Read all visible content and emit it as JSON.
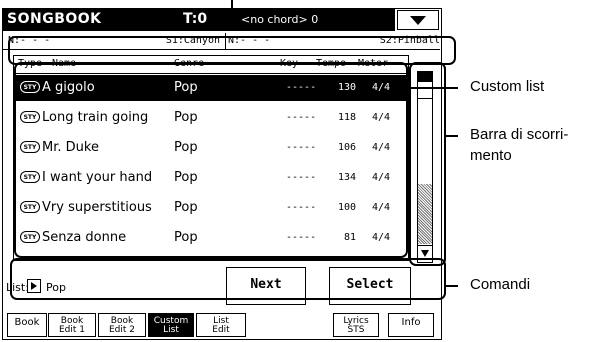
{
  "header": {
    "title": "SONGBOOK",
    "transpose": "T:0",
    "chord": "<no chord> 0"
  },
  "player_info": [
    {
      "n": "N:- - -",
      "song": "S1:Canyon"
    },
    {
      "n": "N:- - -",
      "song": "S2:Pinball"
    }
  ],
  "list": {
    "columns": {
      "type": "Type",
      "name": "Name",
      "genre": "Genre",
      "key": "Key",
      "tempo": "Tempo",
      "meter": "Meter"
    },
    "rows": [
      {
        "type": "STY",
        "name": "A gigolo",
        "genre": "Pop",
        "key": "-----",
        "tempo": "130",
        "meter": "4/4",
        "selected": true
      },
      {
        "type": "STY",
        "name": "Long train going",
        "genre": "Pop",
        "key": "-----",
        "tempo": "118",
        "meter": "4/4",
        "selected": false
      },
      {
        "type": "STY",
        "name": "Mr. Duke",
        "genre": "Pop",
        "key": "-----",
        "tempo": "106",
        "meter": "4/4",
        "selected": false
      },
      {
        "type": "STY",
        "name": "I want your hand",
        "genre": "Pop",
        "key": "-----",
        "tempo": "134",
        "meter": "4/4",
        "selected": false
      },
      {
        "type": "STY",
        "name": "Vry superstitious",
        "genre": "Pop",
        "key": "-----",
        "tempo": "100",
        "meter": "4/4",
        "selected": false
      },
      {
        "type": "STY",
        "name": "Senza donne",
        "genre": "Pop",
        "key": "-----",
        "tempo": "81",
        "meter": "4/4",
        "selected": false
      }
    ]
  },
  "controls": {
    "list_label": "List:",
    "list_value": "Pop",
    "next": "Next",
    "select": "Select"
  },
  "tabs": [
    {
      "line1": "Book",
      "line2": "",
      "active": false
    },
    {
      "line1": "Book",
      "line2": "Edit 1",
      "active": false
    },
    {
      "line1": "Book",
      "line2": "Edit 2",
      "active": false
    },
    {
      "line1": "Custom",
      "line2": "List",
      "active": true
    },
    {
      "line1": "List",
      "line2": "Edit",
      "active": false
    },
    {
      "line1": "Lyrics",
      "line2": "STS",
      "active": false
    },
    {
      "line1": "Info",
      "line2": "",
      "active": false
    }
  ],
  "annotations": {
    "custom_list": "Custom list",
    "scrollbar_1": "Barra di scorri-",
    "scrollbar_2": "mento",
    "commands": "Comandi"
  }
}
